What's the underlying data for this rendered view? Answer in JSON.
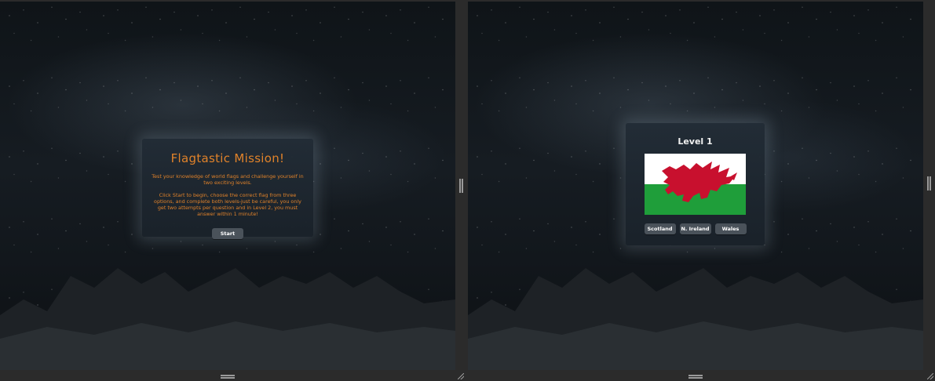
{
  "left_pane": {
    "title": "Flagtastic Mission!",
    "intro": "Test your knowledge of world flags and challenge yourself in two exciting levels.",
    "instructions": "Click Start to begin, choose the correct flag from three options, and complete both levels-just be careful, you only get two attempts per question and in Level 2, you must answer within 1 minute!",
    "start_label": "Start",
    "text_color": "#e0822a"
  },
  "right_pane": {
    "level_title": "Level 1",
    "flag_icon": "wales-flag-icon",
    "options": [
      "Scotland",
      "N. Ireland",
      "Wales"
    ]
  },
  "colors": {
    "flag_white": "#ffffff",
    "flag_green": "#1f9e3a",
    "flag_red": "#c8102e",
    "button_bg": "#4a525a"
  }
}
